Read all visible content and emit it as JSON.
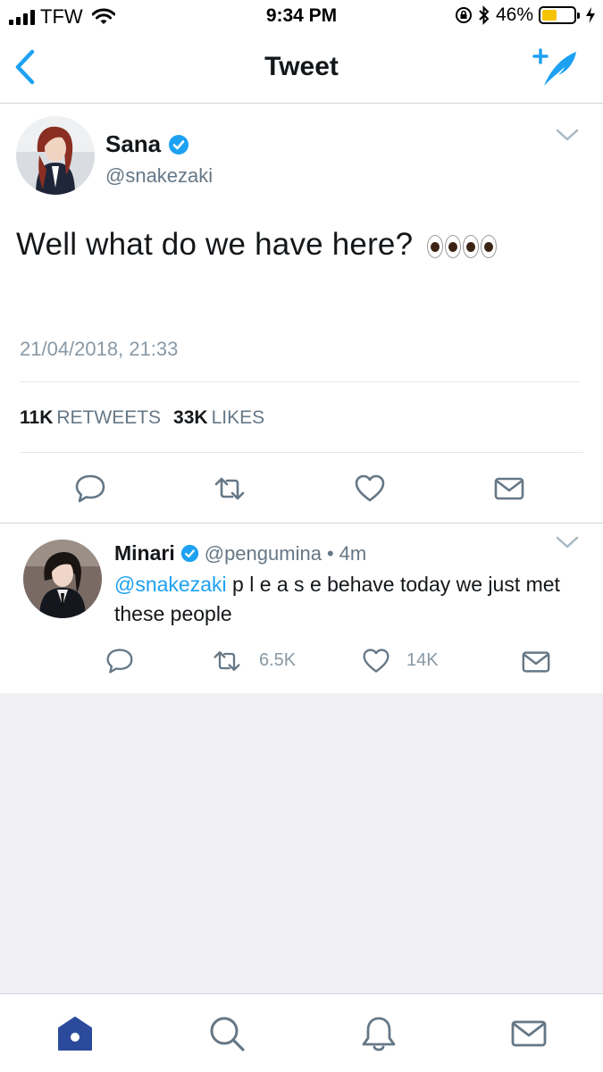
{
  "status_bar": {
    "carrier": "TFW",
    "time": "9:34 PM",
    "battery": "46%",
    "battery_level": 0.46,
    "icons": [
      "signal-icon",
      "wifi-icon",
      "rotation-lock-icon",
      "bluetooth-icon",
      "battery-icon",
      "charging-icon"
    ]
  },
  "nav": {
    "title": "Tweet",
    "back_icon": "chevron-left-icon",
    "compose_icon": "compose-tweet-icon"
  },
  "main_tweet": {
    "display_name": "Sana",
    "handle": "@snakezaki",
    "verified": true,
    "text": "Well what do we have here?",
    "emoji": "eyes-emoji x2",
    "timestamp": "21/04/2018, 21:33",
    "retweets_count": "11K",
    "retweets_label": "RETWEETS",
    "likes_count": "33K",
    "likes_label": "LIKES"
  },
  "reply": {
    "display_name": "Minari",
    "handle": "@pengumina",
    "separator": "•",
    "time": "4m",
    "mention": "@snakezaki",
    "text": " p l e a s e behave today we just met these people",
    "retweets": "6.5K",
    "likes": "14K"
  },
  "colors": {
    "accent": "#1da1f2",
    "text": "#14171a",
    "muted": "#657786",
    "divider": "#e1e8ed",
    "background_empty": "#efeff4",
    "tab_active": "#2b4a9b",
    "battery_fill": "#f5c400"
  },
  "tabs": [
    "home-icon",
    "search-icon",
    "notifications-icon",
    "messages-icon"
  ]
}
